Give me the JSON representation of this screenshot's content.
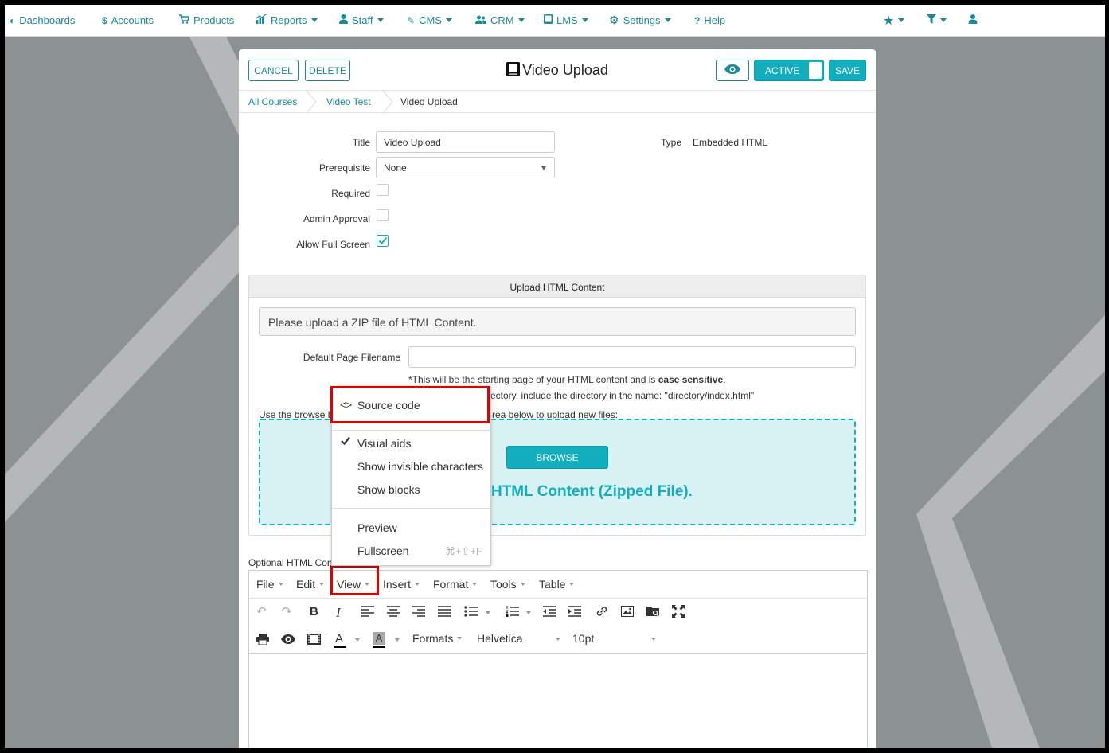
{
  "nav": {
    "items": [
      {
        "label": "Dashboards",
        "icon": "dashboard-icon",
        "caret": false
      },
      {
        "label": "Accounts",
        "icon": "dollar-icon",
        "caret": false
      },
      {
        "label": "Products",
        "icon": "cart-icon",
        "caret": false
      },
      {
        "label": "Reports",
        "icon": "chart-icon",
        "caret": true
      },
      {
        "label": "Staff",
        "icon": "person-icon",
        "caret": true
      },
      {
        "label": "CMS",
        "icon": "pencil-icon",
        "caret": true
      },
      {
        "label": "CRM",
        "icon": "people-icon",
        "caret": true
      },
      {
        "label": "LMS",
        "icon": "book-icon",
        "caret": true
      },
      {
        "label": "Settings",
        "icon": "gear-icon",
        "caret": true
      },
      {
        "label": "Help",
        "icon": "question-icon",
        "caret": false
      }
    ],
    "right_icons": [
      "star-icon",
      "filter-icon",
      "user-icon"
    ]
  },
  "header": {
    "cancel_label": "CANCEL",
    "delete_label": "DELETE",
    "title": "Video Upload",
    "active_label": "ACTIVE",
    "save_label": "SAVE"
  },
  "breadcrumb": [
    "All Courses",
    "Video Test",
    "Video Upload"
  ],
  "form": {
    "title_label": "Title",
    "title_value": "Video Upload",
    "prereq_label": "Prerequisite",
    "prereq_value": "None",
    "required_label": "Required",
    "admin_approval_label": "Admin Approval",
    "fullscreen_label": "Allow Full Screen",
    "type_label": "Type",
    "type_value": "Embedded HTML"
  },
  "upload": {
    "heading": "Upload HTML Content",
    "notice": "Please upload a ZIP file of HTML Content.",
    "default_page_label": "Default Page Filename",
    "hint1_pre": "*This will be the starting page of your HTML content and is ",
    "hint1_bold": "case sensitive",
    "hint1_post": ".",
    "hint2_visible": "ectory, include the directory in the name: \"directory/index.html\"",
    "browse_help_left": "Use the browse b",
    "browse_help_right": "rea below to upload new files:",
    "browse_label": "BROWSE",
    "drop_text_visible": "p HTML Content (Zipped File)."
  },
  "editor": {
    "label_visible": "Optional HTML Con",
    "menus": [
      "File",
      "Edit",
      "View",
      "Insert",
      "Format",
      "Tools",
      "Table"
    ],
    "formats_label": "Formats",
    "font_value": "Helvetica",
    "size_value": "10pt"
  },
  "view_menu": {
    "source_code": "Source code",
    "visual_aids": "Visual aids",
    "invisible_chars": "Show invisible characters",
    "show_blocks": "Show blocks",
    "preview": "Preview",
    "fullscreen": "Fullscreen",
    "fullscreen_shortcut": "⌘+⇧+F"
  },
  "colors": {
    "accent": "#12aebd",
    "link": "#1a8a9a",
    "highlight": "#e00000",
    "background": "#8c9192"
  }
}
